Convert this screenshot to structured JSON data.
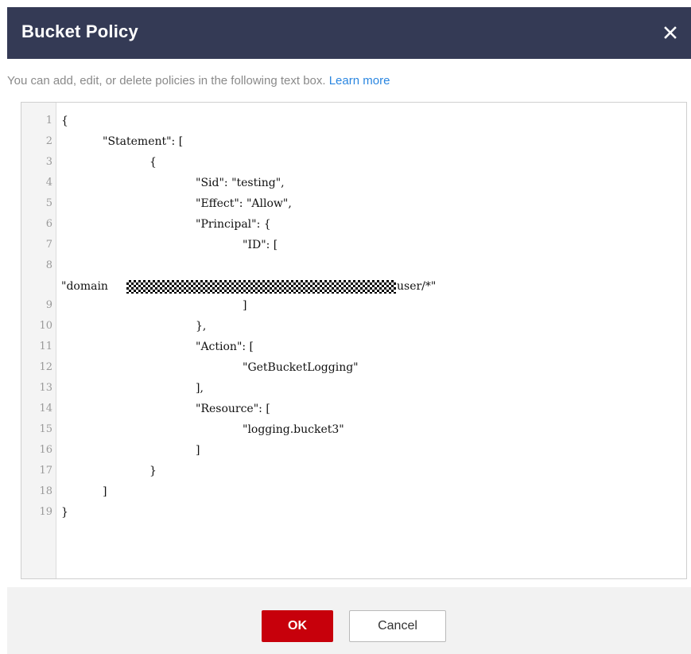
{
  "dialog": {
    "title": "Bucket Policy",
    "close_icon": "close-icon",
    "description": "You can add, edit, or delete policies in the following text box.",
    "learn_more": "Learn more"
  },
  "editor": {
    "line_numbers": [
      "1",
      "2",
      "3",
      "4",
      "5",
      "6",
      "7",
      "8",
      "9",
      "10",
      "11",
      "12",
      "13",
      "14",
      "15",
      "16",
      "17",
      "18",
      "19"
    ],
    "lines": [
      "{",
      "\"Statement\": [",
      "{",
      "\"Sid\": \"testing\",",
      "\"Effect\": \"Allow\",",
      "\"Principal\": {",
      "\"ID\": [",
      "\"domain",
      "user/*\"",
      "]",
      "},",
      "\"Action\": [",
      "\"GetBucketLogging\"",
      "],",
      "\"Resource\": [",
      "\"logging.bucket3\"",
      "]",
      "}",
      "]",
      "}"
    ]
  },
  "footer": {
    "ok_label": "OK",
    "cancel_label": "Cancel"
  },
  "colors": {
    "header_bg": "#343a55",
    "ok_bg": "#c7000b",
    "link": "#2a86e0"
  }
}
